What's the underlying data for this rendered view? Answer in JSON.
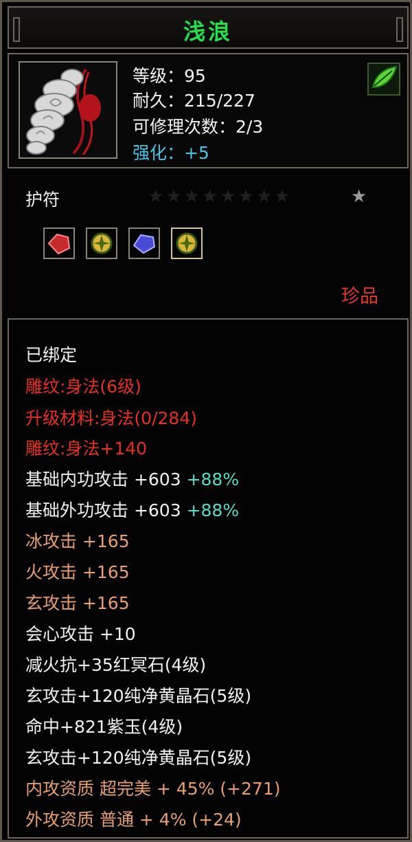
{
  "item": {
    "name": "浅浪",
    "level": "等级：95",
    "durability": "耐久：215/227",
    "repair": "可修理次数：2/3",
    "enhance": "强化：+5",
    "type": "护符",
    "rarity": "珍品",
    "icon": "amulet-jade-icon",
    "grade_icon": "green-leaf-grade-icon",
    "stars_total": 9,
    "stars_lit": 1
  },
  "gems": [
    {
      "icon": "red-gem-icon",
      "color": "#c62a2a"
    },
    {
      "icon": "yellow-crystal-icon",
      "color": "#d9b53a"
    },
    {
      "icon": "purple-jade-icon",
      "color": "#4a4ad8"
    },
    {
      "icon": "yellow-crystal-icon",
      "color": "#d9b53a"
    }
  ],
  "details": {
    "bound": "已绑定",
    "carve": "雕纹:身法(6级)",
    "upgrade": "升级材料:身法(0/284)",
    "carve_bonus": "雕纹:身法+140",
    "inner_attack": "基础内功攻击 +603",
    "inner_attack_pct": "+88%",
    "outer_attack": "基础外功攻击 +603",
    "outer_attack_pct": "+88%",
    "ice": "冰攻击 +165",
    "fire": "火攻击 +165",
    "xuan": "玄攻击 +165",
    "crit": "会心攻击 +10",
    "socket1": "减火抗+35红冥石(4级)",
    "socket2": "玄攻击+120纯净黄晶石(5级)",
    "socket3": "命中+821紫玉(4级)",
    "socket4": "玄攻击+120纯净黄晶石(5级)",
    "inner_quality": "内攻资质 超完美 + 45% (+271)",
    "outer_quality": "外攻资质 普通 + 4% (+24)"
  },
  "colors": {
    "name": "#25e04a",
    "enhance": "#45c6e6",
    "red": "#e63024",
    "orange": "#e8a070",
    "pct": "#55dcc8"
  }
}
